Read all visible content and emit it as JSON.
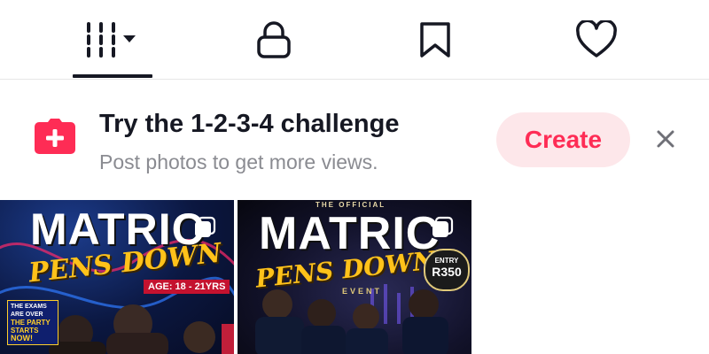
{
  "tabs": [
    {
      "id": "videos",
      "icon": "grid-bars-icon",
      "has_dropdown": true,
      "active": true
    },
    {
      "id": "private",
      "icon": "lock-icon"
    },
    {
      "id": "saved",
      "icon": "bookmark-icon"
    },
    {
      "id": "liked",
      "icon": "heart-icon"
    }
  ],
  "banner": {
    "icon": "camera-plus-icon",
    "title": "Try the 1-2-3-4 challenge",
    "subtitle": "Post photos to get more views.",
    "create_label": "Create",
    "close_icon": "close-icon"
  },
  "thumbnails": [
    {
      "title": "MATRIC",
      "script": "PENS DOWN",
      "age_tag": "AGE: 18 - 21YRS",
      "side_note_1": "THE EXAMS",
      "side_note_2": "ARE OVER",
      "side_note_3": "THE PARTY",
      "side_note_4": "STARTS",
      "side_note_5": "NOW!",
      "multi_icon": "multiple-photos-icon"
    },
    {
      "kicker": "THE OFFICIAL",
      "title": "MATRIC",
      "script": "PENS DOWN",
      "event": "EVENT",
      "entry_label": "ENTRY",
      "entry_price": "R350",
      "multi_icon": "multiple-photos-icon"
    }
  ],
  "colors": {
    "accent": "#fe2c55",
    "create_bg": "#fde7ea",
    "text_primary": "#161823",
    "text_secondary": "#8a8b91",
    "script_yellow": "#ffc21a"
  }
}
